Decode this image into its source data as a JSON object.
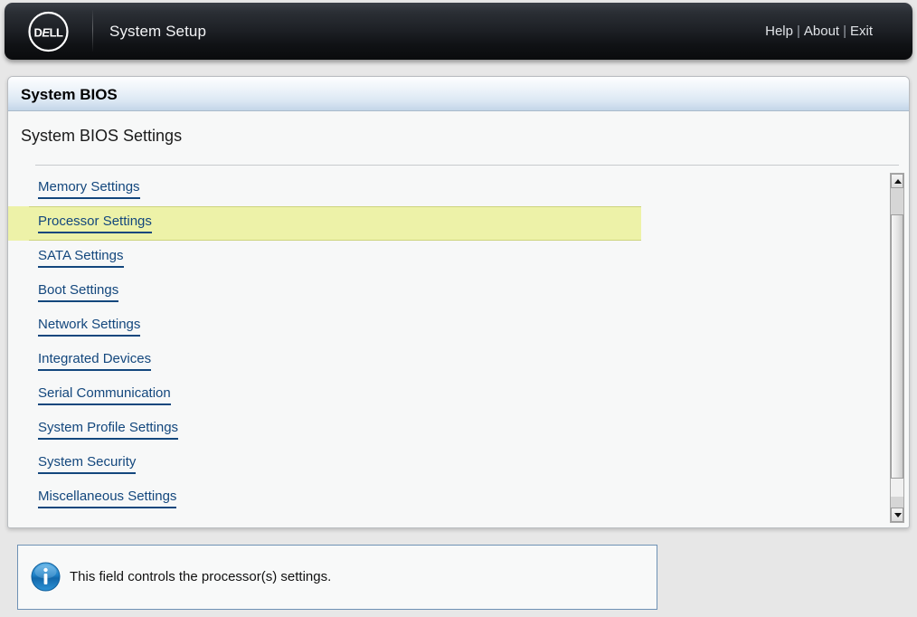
{
  "header": {
    "logo_text": "DELL",
    "logo_icon": "dell-logo-icon",
    "title": "System Setup",
    "links": [
      {
        "label": "Help"
      },
      {
        "label": "About"
      },
      {
        "label": "Exit"
      }
    ],
    "separator": "|"
  },
  "panel": {
    "title": "System BIOS",
    "subtitle": "System BIOS Settings"
  },
  "menu": {
    "items": [
      {
        "label": "Memory Settings",
        "selected": false
      },
      {
        "label": "Processor Settings",
        "selected": true
      },
      {
        "label": "SATA Settings",
        "selected": false
      },
      {
        "label": "Boot Settings",
        "selected": false
      },
      {
        "label": "Network Settings",
        "selected": false
      },
      {
        "label": "Integrated Devices",
        "selected": false
      },
      {
        "label": "Serial Communication",
        "selected": false
      },
      {
        "label": "System Profile Settings",
        "selected": false
      },
      {
        "label": "System Security",
        "selected": false
      },
      {
        "label": "Miscellaneous Settings",
        "selected": false
      }
    ]
  },
  "scrollbar": {
    "up_icon": "chevron-up-icon",
    "down_icon": "chevron-down-icon"
  },
  "info_bar": {
    "icon": "info-icon",
    "text": "This field controls the processor(s) settings."
  },
  "colors": {
    "header_bg": "#0f1114",
    "panel_title_bg": "#dbe7f3",
    "link": "#13477d",
    "selected_row": "#edf2a8",
    "info_border": "#6e91b5",
    "page_bg": "#e7e7e7"
  }
}
